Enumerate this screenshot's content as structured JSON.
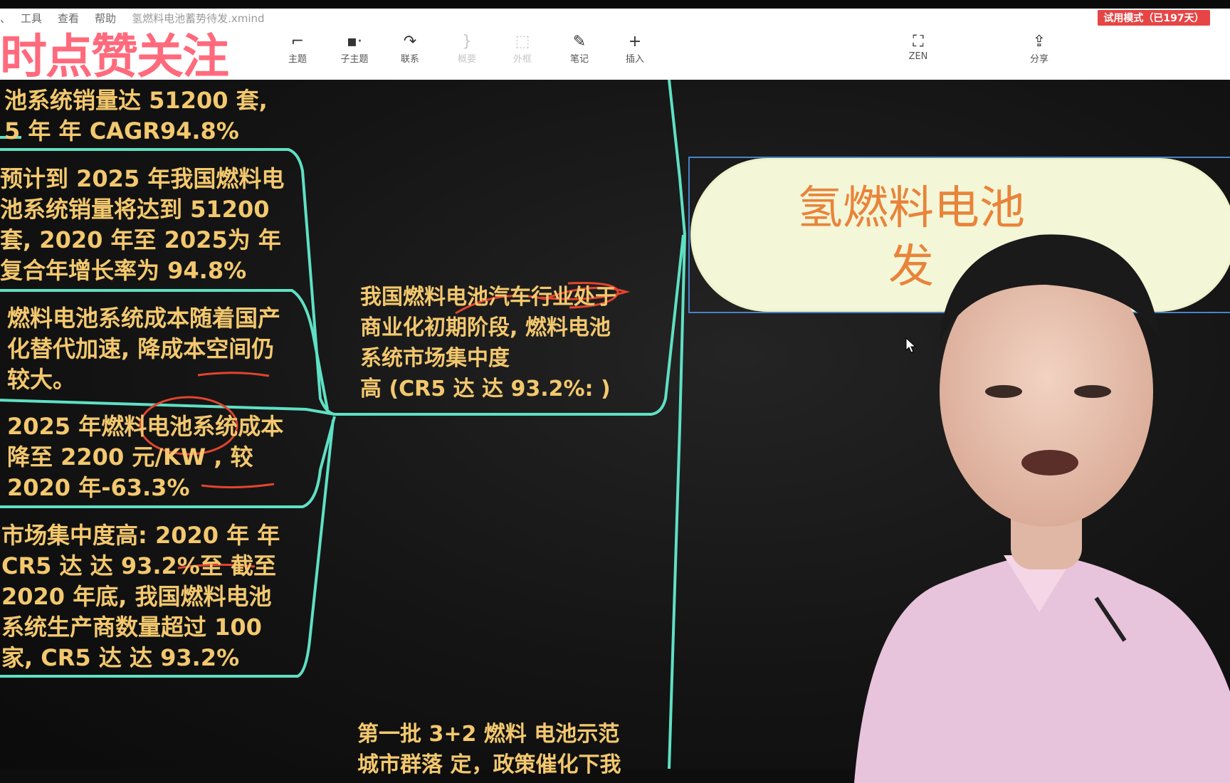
{
  "menu": {
    "items": [
      "工具",
      "查看",
      "帮助"
    ],
    "file_name": "氢燃料电池蓄势待发.xmind",
    "left_fragment": "、"
  },
  "trial_badge": "试用模式（已197天）",
  "toolbar": {
    "topic": "主题",
    "subtopic": "子主题",
    "relation": "联系",
    "summary": "概要",
    "boundary": "外框",
    "note": "笔记",
    "insert": "插入",
    "zen": "ZEN",
    "share": "分享"
  },
  "overlay": {
    "promo": "时点赞关注"
  },
  "mindmap": {
    "root": {
      "line1": "氢燃料电池",
      "line2": "发"
    },
    "left_nodes": [
      [
        "池系统销量达 51200  套,",
        "5 年 年 CAGR94.8%"
      ],
      [
        "预计到 2025  年我国燃料电",
        "池系统销量将达到 51200",
        "套, 2020  年至 2025为 年",
        "复合年增长率为 94.8%"
      ],
      [
        "燃料电池系统成本随着国产",
        "化替代加速, 降成本空间仍",
        "较大。"
      ],
      [
        "2025  年燃料电池系统成本",
        "降至 2200  元/KW , 较",
        "2020  年-63.3%"
      ],
      [
        "市场集中度高: 2020 年 年",
        "CR5 达 达 93.2%至 截至",
        "2020  年底, 我国燃料电池",
        "系统生产商数量超过 100",
        "家, CR5 达 达 93.2%"
      ]
    ],
    "mid_node": [
      "我国燃料电池汽车行业处于",
      "商业化初期阶段, 燃料电池",
      "系统市场集中度",
      "高 (CR5 达 达 93.2%:  )"
    ],
    "bottom_node": [
      "第一批 3+2  燃料 电池示范",
      "城市群落 定，政策催化下我"
    ]
  },
  "colors": {
    "accent_line": "#5fe0c4",
    "node_text": "#f3c86e",
    "root_text": "#e8843a",
    "annotation": "#e2442f",
    "trial": "#e64545"
  }
}
